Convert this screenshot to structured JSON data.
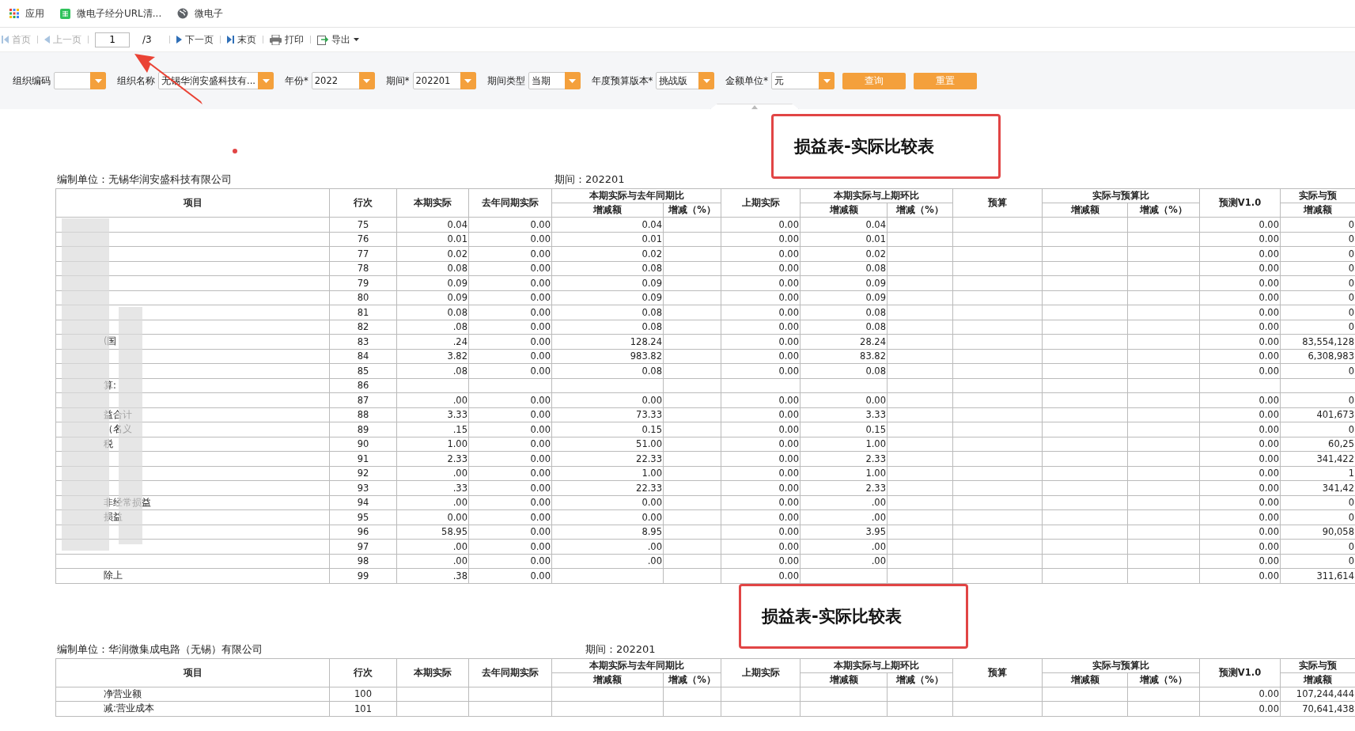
{
  "bookmarks": [
    {
      "kind": "apps",
      "label": "应用"
    },
    {
      "kind": "sheet",
      "label": "微电子经分URL清..."
    },
    {
      "kind": "globe",
      "label": "微电子"
    }
  ],
  "toolbar": {
    "first": {
      "label": "首页",
      "disabled": true
    },
    "prev": {
      "label": "上一页",
      "disabled": true
    },
    "page": "1",
    "total": "/3",
    "next": {
      "label": "下一页",
      "disabled": false
    },
    "last": {
      "label": "末页",
      "disabled": false
    },
    "print": "打印",
    "export": "导出"
  },
  "filters": [
    {
      "label": "组织编码"
    },
    {
      "label": "组织名称",
      "value": "无锡华润安盛科技有..."
    },
    {
      "label": "年份*",
      "value": "2022"
    },
    {
      "label": "期间*",
      "value": "202201"
    },
    {
      "label": "期间类型",
      "value": "当期"
    },
    {
      "label": "年度预算版本*",
      "value": "挑战版"
    },
    {
      "label": "金额单位*",
      "value": "元"
    }
  ],
  "buttons": [
    "查询",
    "重置"
  ],
  "sections": [
    {
      "title": "损益表-实际比较表",
      "unit": "编制单位：无锡华润安盛科技有限公司",
      "period": "期间：202201",
      "header": [
        {
          "label": "项目"
        },
        {
          "label": "行次"
        },
        {
          "label": "本期实际"
        },
        {
          "label": "去年同期实际"
        },
        {
          "label": "本期实际与去年同期比",
          "children": [
            "增减额",
            "增减（%）"
          ]
        },
        {
          "label": "上期实际"
        },
        {
          "label": "本期实际与上期环比",
          "children": [
            "增减额",
            "增减（%）"
          ]
        },
        {
          "label": "预算"
        },
        {
          "label": "实际与预算比",
          "children": [
            "增减额",
            "增减（%）"
          ]
        },
        {
          "label": "预测V1.0"
        },
        {
          "label": "实际与预",
          "children": [
            "增减额"
          ]
        }
      ],
      "rows": [
        {
          "cells": [
            null,
            "75",
            "0.04",
            "0.00",
            "0.04",
            null,
            "0.00",
            "0.04",
            null,
            null,
            null,
            null,
            "0.00",
            "0"
          ]
        },
        {
          "cells": [
            null,
            "76",
            "0.01",
            "0.00",
            "0.01",
            null,
            "0.00",
            "0.01",
            null,
            null,
            null,
            null,
            "0.00",
            "0"
          ]
        },
        {
          "cells": [
            null,
            "77",
            "0.02",
            "0.00",
            "0.02",
            null,
            "0.00",
            "0.02",
            null,
            null,
            null,
            null,
            "0.00",
            "0"
          ]
        },
        {
          "cells": [
            null,
            "78",
            "0.08",
            "0.00",
            "0.08",
            null,
            "0.00",
            "0.08",
            null,
            null,
            null,
            null,
            "0.00",
            "0"
          ]
        },
        {
          "cells": [
            null,
            "79",
            "0.09",
            "0.00",
            "0.09",
            null,
            "0.00",
            "0.09",
            null,
            null,
            null,
            null,
            "0.00",
            "0"
          ]
        },
        {
          "cells": [
            null,
            "80",
            "0.09",
            "0.00",
            "0.09",
            null,
            "0.00",
            "0.09",
            null,
            null,
            null,
            null,
            "0.00",
            "0"
          ]
        },
        {
          "cells": [
            null,
            "81",
            "0.08",
            "0.00",
            "0.08",
            null,
            "0.00",
            "0.08",
            null,
            null,
            null,
            null,
            "0.00",
            "0"
          ]
        },
        {
          "cells": [
            null,
            "82",
            ".08",
            "0.00",
            "0.08",
            null,
            "0.00",
            "0.08",
            null,
            null,
            null,
            null,
            "0.00",
            "0"
          ]
        },
        {
          "cells": [
            "(国",
            "83",
            ".24",
            "0.00",
            "128.24",
            null,
            "0.00",
            "28.24",
            null,
            null,
            null,
            null,
            "0.00",
            "83,554,128"
          ]
        },
        {
          "cells": [
            null,
            "84",
            "3.82",
            "0.00",
            "983.82",
            null,
            "0.00",
            "83.82",
            null,
            null,
            null,
            null,
            "0.00",
            "6,308,983"
          ]
        },
        {
          "cells": [
            null,
            "85",
            ".08",
            "0.00",
            "0.08",
            null,
            "0.00",
            "0.08",
            null,
            null,
            null,
            null,
            "0.00",
            "0"
          ]
        },
        {
          "cells": [
            "算:",
            "86",
            null,
            null,
            null,
            null,
            null,
            null,
            null,
            null,
            null,
            null,
            null,
            null
          ]
        },
        {
          "cells": [
            null,
            "87",
            ".00",
            "0.00",
            "0.00",
            null,
            "0.00",
            "0.00",
            null,
            null,
            null,
            null,
            "0.00",
            "0"
          ]
        },
        {
          "cells": [
            "益合计",
            "88",
            "3.33",
            "0.00",
            "73.33",
            null,
            "0.00",
            "3.33",
            null,
            null,
            null,
            null,
            "0.00",
            "401,673"
          ]
        },
        {
          "cells": [
            "（名义",
            "89",
            ".15",
            "0.00",
            "0.15",
            null,
            "0.00",
            "0.15",
            null,
            null,
            null,
            null,
            "0.00",
            "0"
          ]
        },
        {
          "cells": [
            "税",
            "90",
            "1.00",
            "0.00",
            "51.00",
            null,
            "0.00",
            "1.00",
            null,
            null,
            null,
            null,
            "0.00",
            "60,25"
          ]
        },
        {
          "cells": [
            null,
            "91",
            "2.33",
            "0.00",
            "22.33",
            null,
            "0.00",
            "2.33",
            null,
            null,
            null,
            null,
            "0.00",
            "341,422"
          ]
        },
        {
          "cells": [
            null,
            "92",
            ".00",
            "0.00",
            "1.00",
            null,
            "0.00",
            "1.00",
            null,
            null,
            null,
            null,
            "0.00",
            "1"
          ]
        },
        {
          "cells": [
            null,
            "93",
            ".33",
            "0.00",
            "22.33",
            null,
            "0.00",
            "2.33",
            null,
            null,
            null,
            null,
            "0.00",
            "341,42"
          ]
        },
        {
          "cells": [
            "非经常损益",
            "94",
            ".00",
            "0.00",
            "0.00",
            null,
            "0.00",
            ".00",
            null,
            null,
            null,
            null,
            "0.00",
            "0"
          ]
        },
        {
          "cells": [
            "损益",
            "95",
            "0.00",
            "0.00",
            "0.00",
            null,
            "0.00",
            ".00",
            null,
            null,
            null,
            null,
            "0.00",
            "0"
          ]
        },
        {
          "cells": [
            null,
            "96",
            "58.95",
            "0.00",
            "8.95",
            null,
            "0.00",
            "3.95",
            null,
            null,
            null,
            null,
            "0.00",
            "90,058"
          ]
        },
        {
          "cells": [
            null,
            "97",
            ".00",
            "0.00",
            ".00",
            null,
            "0.00",
            ".00",
            null,
            null,
            null,
            null,
            "0.00",
            "0"
          ]
        },
        {
          "cells": [
            null,
            "98",
            ".00",
            "0.00",
            ".00",
            null,
            "0.00",
            ".00",
            null,
            null,
            null,
            null,
            "0.00",
            "0"
          ]
        },
        {
          "cells": [
            "除上",
            "99",
            ".38",
            "0.00",
            null,
            null,
            "0.00",
            null,
            null,
            null,
            null,
            null,
            "0.00",
            "311,614"
          ]
        }
      ]
    },
    {
      "title": "损益表-实际比较表",
      "unit": "编制单位：华润微集成电路（无锡）有限公司",
      "period": "期间：202201",
      "header": [
        {
          "label": "项目"
        },
        {
          "label": "行次"
        },
        {
          "label": "本期实际"
        },
        {
          "label": "去年同期实际"
        },
        {
          "label": "本期实际与去年同期比",
          "children": [
            "增减额",
            "增减（%）"
          ]
        },
        {
          "label": "上期实际"
        },
        {
          "label": "本期实际与上期环比",
          "children": [
            "增减额",
            "增减（%）"
          ]
        },
        {
          "label": "预算"
        },
        {
          "label": "实际与预算比",
          "children": [
            "增减额",
            "增减（%）"
          ]
        },
        {
          "label": "预测V1.0"
        },
        {
          "label": "实际与预",
          "children": [
            "增减额"
          ]
        }
      ],
      "rows": [
        {
          "cells": [
            "净营业额",
            "100",
            null,
            null,
            null,
            null,
            null,
            null,
            null,
            null,
            null,
            null,
            "0.00",
            "107,244,444"
          ]
        },
        {
          "cells": [
            "减:营业成本",
            "101",
            null,
            null,
            null,
            null,
            null,
            null,
            null,
            null,
            null,
            null,
            "0.00",
            "70,641,438"
          ]
        }
      ]
    }
  ]
}
